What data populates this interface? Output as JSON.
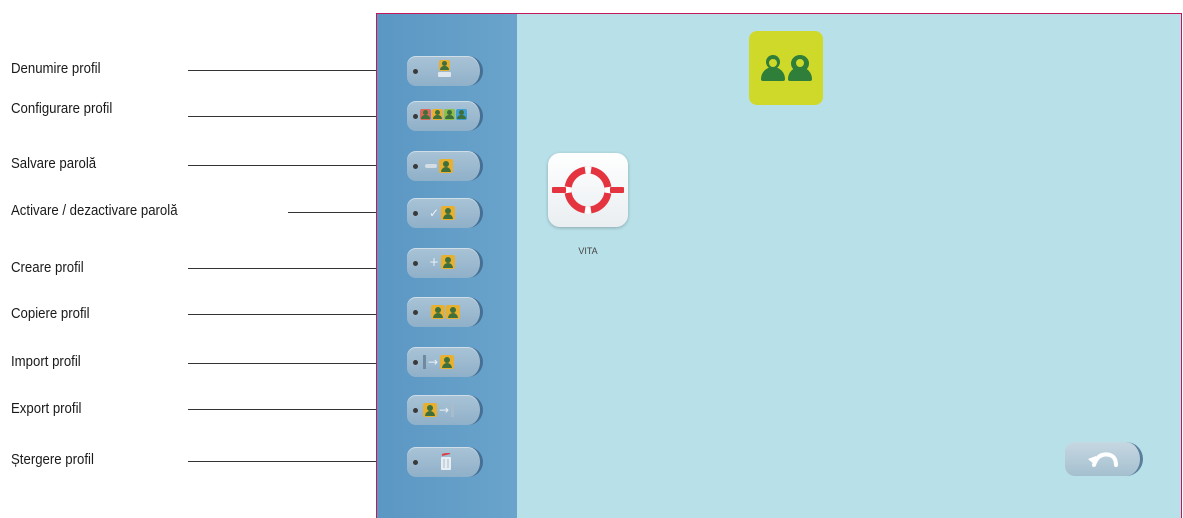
{
  "annotations": [
    {
      "label": "Denumire profil"
    },
    {
      "label": "Configurare profil"
    },
    {
      "label": "Salvare parolă"
    },
    {
      "label": "Activare / dezactivare parolă"
    },
    {
      "label": "Creare profil"
    },
    {
      "label": "Copiere profil"
    },
    {
      "label": "Import profil"
    },
    {
      "label": "Export profil"
    },
    {
      "label": "Ștergere profil"
    }
  ],
  "sidebar": {
    "buttons": [
      {
        "icon": "profile-name-icon"
      },
      {
        "icon": "profile-config-icon"
      },
      {
        "icon": "key-profile-icon"
      },
      {
        "icon": "lock-profile-icon"
      },
      {
        "icon": "add-profile-icon"
      },
      {
        "icon": "copy-profile-icon"
      },
      {
        "icon": "import-profile-icon"
      },
      {
        "icon": "export-profile-icon"
      },
      {
        "icon": "trash-icon"
      }
    ]
  },
  "main": {
    "header_icon": "users-icon",
    "header_icon_color": "#cfd92a",
    "apps": [
      {
        "label": "VITA",
        "icon": "lifebuoy-icon",
        "color": "#e3343f"
      }
    ],
    "back_button": {
      "icon": "back-arrow-icon"
    }
  },
  "colors": {
    "screen_border": "#c2185b",
    "sidebar": "#5b97c3",
    "main_bg": "#b8e0e8"
  }
}
